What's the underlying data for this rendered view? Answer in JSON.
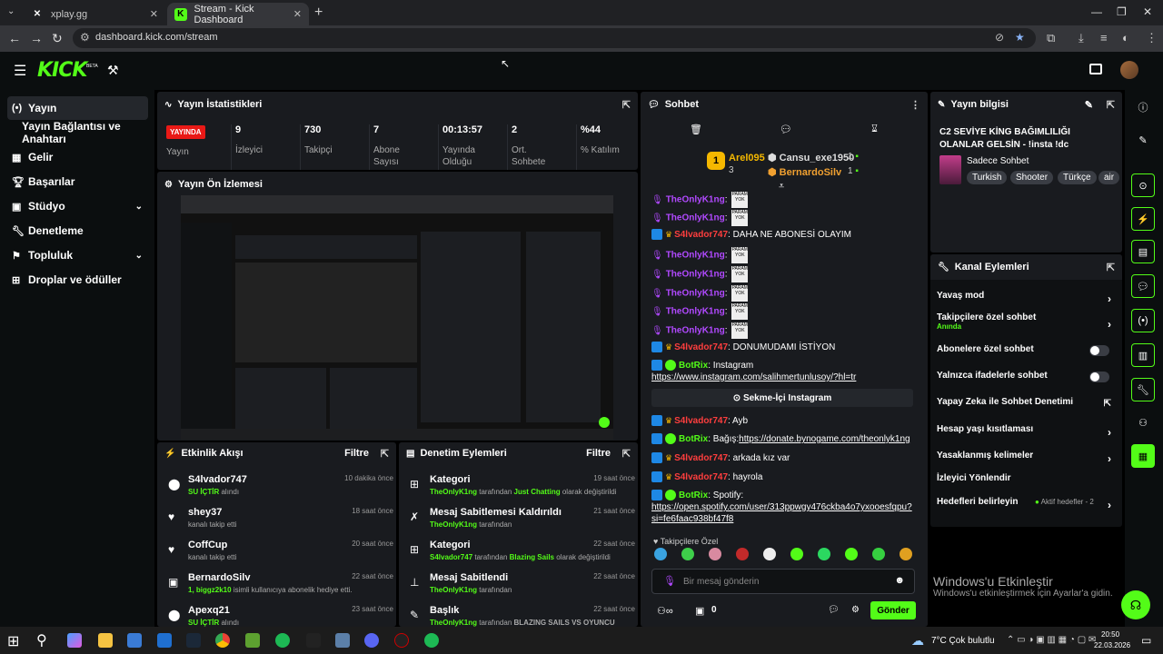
{
  "browser": {
    "tabs": [
      {
        "title": "xplay.gg"
      },
      {
        "title": "Stream - Kick Dashboard"
      }
    ],
    "url": "dashboard.kick.com/stream"
  },
  "header": {
    "logo": "KICK",
    "beta": "BETA"
  },
  "sidebar": {
    "items": [
      {
        "label": "Yayın",
        "icon": "broadcast-icon"
      },
      {
        "label": "Yayın Bağlantısı ve Anahtarı"
      },
      {
        "label": "Gelir",
        "icon": "income-icon"
      },
      {
        "label": "Başarılar",
        "icon": "trophy-icon"
      },
      {
        "label": "Stüdyo",
        "icon": "studio-icon"
      },
      {
        "label": "Denetleme",
        "icon": "wrench-icon"
      },
      {
        "label": "Topluluk",
        "icon": "community-icon"
      },
      {
        "label": "Droplar ve ödüller",
        "icon": "drops-icon"
      }
    ]
  },
  "stats": {
    "title": "Yayın İstatistikleri",
    "live_badge": "YAYINDA",
    "live_label": "Yayın",
    "items": [
      {
        "value": "9",
        "label": "İzleyici"
      },
      {
        "value": "730",
        "label": "Takipçi"
      },
      {
        "value": "7",
        "label": "Abone Sayısı"
      },
      {
        "value": "00:13:57",
        "label": "Yayında Olduğu"
      },
      {
        "value": "2",
        "label": "Ort. Sohbete"
      },
      {
        "value": "%44",
        "label": "% Katılım"
      }
    ]
  },
  "preview": {
    "title": "Yayın Ön İzlemesi"
  },
  "activity": {
    "title": "Etkinlik Akışı",
    "filter": "Filtre",
    "items": [
      {
        "name": "S4lvador747",
        "sub": "SU İÇTİR",
        "sub2": "alındı",
        "time": "10 dakika önce"
      },
      {
        "name": "shey37",
        "sub": "kanalı takip etti",
        "time": "18 saat önce"
      },
      {
        "name": "CoffCup",
        "sub": "kanalı takip etti",
        "time": "20 saat önce"
      },
      {
        "name": "BernardoSilv",
        "sub": "1, biggz2k10",
        "sub2": "isimli kullanıcıya abonelik hediye etti.",
        "time": "22 saat önce"
      },
      {
        "name": "Apexq21",
        "sub": "SU İÇTİR",
        "sub2": "alındı",
        "time": "23 saat önce"
      }
    ]
  },
  "moderation": {
    "title": "Denetim Eylemleri",
    "filter": "Filtre",
    "items": [
      {
        "name": "Kategori",
        "user": "TheOnlyK1ng",
        "text": "tarafından",
        "extra": "Just Chatting",
        "text2": "olarak değiştirildi",
        "time": "19 saat önce"
      },
      {
        "name": "Mesaj Sabitlemesi Kaldırıldı",
        "user": "TheOnlyK1ng",
        "text": "tarafından",
        "time": "21 saat önce"
      },
      {
        "name": "Kategori",
        "user": "S4lvador747",
        "text": "tarafından",
        "extra": "Blazing Sails",
        "text2": "olarak değiştirildi",
        "time": "22 saat önce"
      },
      {
        "name": "Mesaj Sabitlendi",
        "user": "TheOnlyK1ng",
        "text": "tarafından",
        "time": "22 saat önce"
      },
      {
        "name": "Başlık",
        "user": "TheOnlyK1ng",
        "text": "tarafından",
        "extra": "BLAZING SAILS VS OYUNCU",
        "time": "22 saat önce"
      }
    ]
  },
  "chat": {
    "title": "Sohbet",
    "leaders": {
      "first": {
        "name": "Arel095",
        "count": "3"
      },
      "second": {
        "name": "Cansu_exe1950",
        "count": "1"
      },
      "third": {
        "name": "BernardoSilv",
        "count": "1"
      }
    },
    "sticker_text": "PARAM YOK",
    "messages": [
      {
        "user": "TheOnlyK1ng"
      },
      {
        "user": "TheOnlyK1ng"
      },
      {
        "user": "S4lvador747",
        "text": "DAHA NE ABONESİ OLAYIM"
      },
      {
        "user": "TheOnlyK1ng"
      },
      {
        "user": "TheOnlyK1ng"
      },
      {
        "user": "TheOnlyK1ng"
      },
      {
        "user": "TheOnlyK1ng"
      },
      {
        "user": "TheOnlyK1ng"
      },
      {
        "user": "S4lvador747",
        "text": "DONUMUDAMI İSTİYON"
      },
      {
        "user": "BotRix",
        "text": "Instagram",
        "link": "https://www.instagram.com/salihmertunlusoy/?hl=tr"
      },
      {
        "user": "S4lvador747",
        "text": "Ayb"
      },
      {
        "user": "BotRix",
        "text": "Bağış:",
        "link": "https://donate.bynogame.com/theonlyk1ng"
      },
      {
        "user": "S4lvador747",
        "text": "arkada kız var"
      },
      {
        "user": "S4lvador747",
        "text": "hayrola"
      },
      {
        "user": "BotRix",
        "text": "Spotify:",
        "link": "https://open.spotify.com/user/313ppwgy476ckba4o7yxooesfqpu?si=fe6faac938bf47f8"
      }
    ],
    "instagram_button": "Sekme-İçi Instagram",
    "followers_only": "Takipçilere Özel",
    "input_placeholder": "Bir mesaj gönderin",
    "points": "0",
    "send": "Gönder"
  },
  "stream_info": {
    "title": "Yayın bilgisi",
    "stream_title": "C2 SEVİYE KİNG BAĞIMLILIĞI OLANLAR GELSİN - !insta !dc",
    "category": "Sadece Sohbet",
    "tags": [
      "Turkish",
      "Shooter",
      "Türkçe",
      "air"
    ]
  },
  "channel_actions": {
    "title": "Kanal Eylemleri",
    "items": [
      {
        "label": "Yavaş mod",
        "type": "arrow"
      },
      {
        "label": "Takipçilere özel sohbet",
        "sub": "Anında",
        "type": "arrow"
      },
      {
        "label": "Abonelere özel sohbet",
        "type": "toggle"
      },
      {
        "label": "Yalnızca ifadelerle sohbet",
        "type": "toggle"
      },
      {
        "label": "Yapay Zeka ile Sohbet Denetimi",
        "type": "external"
      },
      {
        "label": "Hesap yaşı kısıtlaması",
        "type": "arrow"
      },
      {
        "label": "Yasaklanmış kelimeler",
        "type": "arrow"
      },
      {
        "label": "İzleyici Yönlendir",
        "type": "none"
      },
      {
        "label": "Hedefleri belirleyin",
        "extra": "Aktif hedefler - 2",
        "type": "arrow"
      }
    ]
  },
  "windows": {
    "activate_title": "Windows'u Etkinleştir",
    "activate_sub": "Windows'u etkinleştirmek için Ayarlar'a gidin.",
    "weather": "7°C  Çok bulutlu",
    "time": "20:50",
    "date": "22.03.2026"
  },
  "colors": {
    "accent": "#53fc18",
    "live": "#e91916",
    "panel": "#191b1f"
  }
}
